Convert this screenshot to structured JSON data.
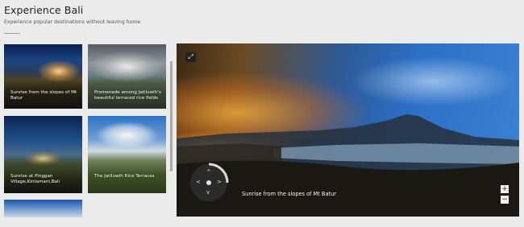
{
  "header": {
    "title": "Experience Bali",
    "subtitle": "Experience popular destinations without leaving home"
  },
  "gallery": {
    "items": [
      {
        "caption": "Sunrise from the slopes of Mt Batur"
      },
      {
        "caption": "Promenade among Jatiluwih's beautiful terraced rice fields"
      },
      {
        "caption": "Sunrise at Pinggan Village,Kintamani,Bali"
      },
      {
        "caption": "The Jatiluwih Rice Terraces"
      },
      {
        "caption": ""
      }
    ]
  },
  "viewer": {
    "caption": "Sunrise from the slopes of Mt Batur",
    "expand_icon": "⤢",
    "zoom_in": "+",
    "zoom_out": "−",
    "nav_up": "^",
    "nav_down": "v",
    "nav_left": "<",
    "nav_right": ">"
  },
  "colors": {
    "background": "#ebebeb",
    "control_dark": "#2b2b2b"
  }
}
